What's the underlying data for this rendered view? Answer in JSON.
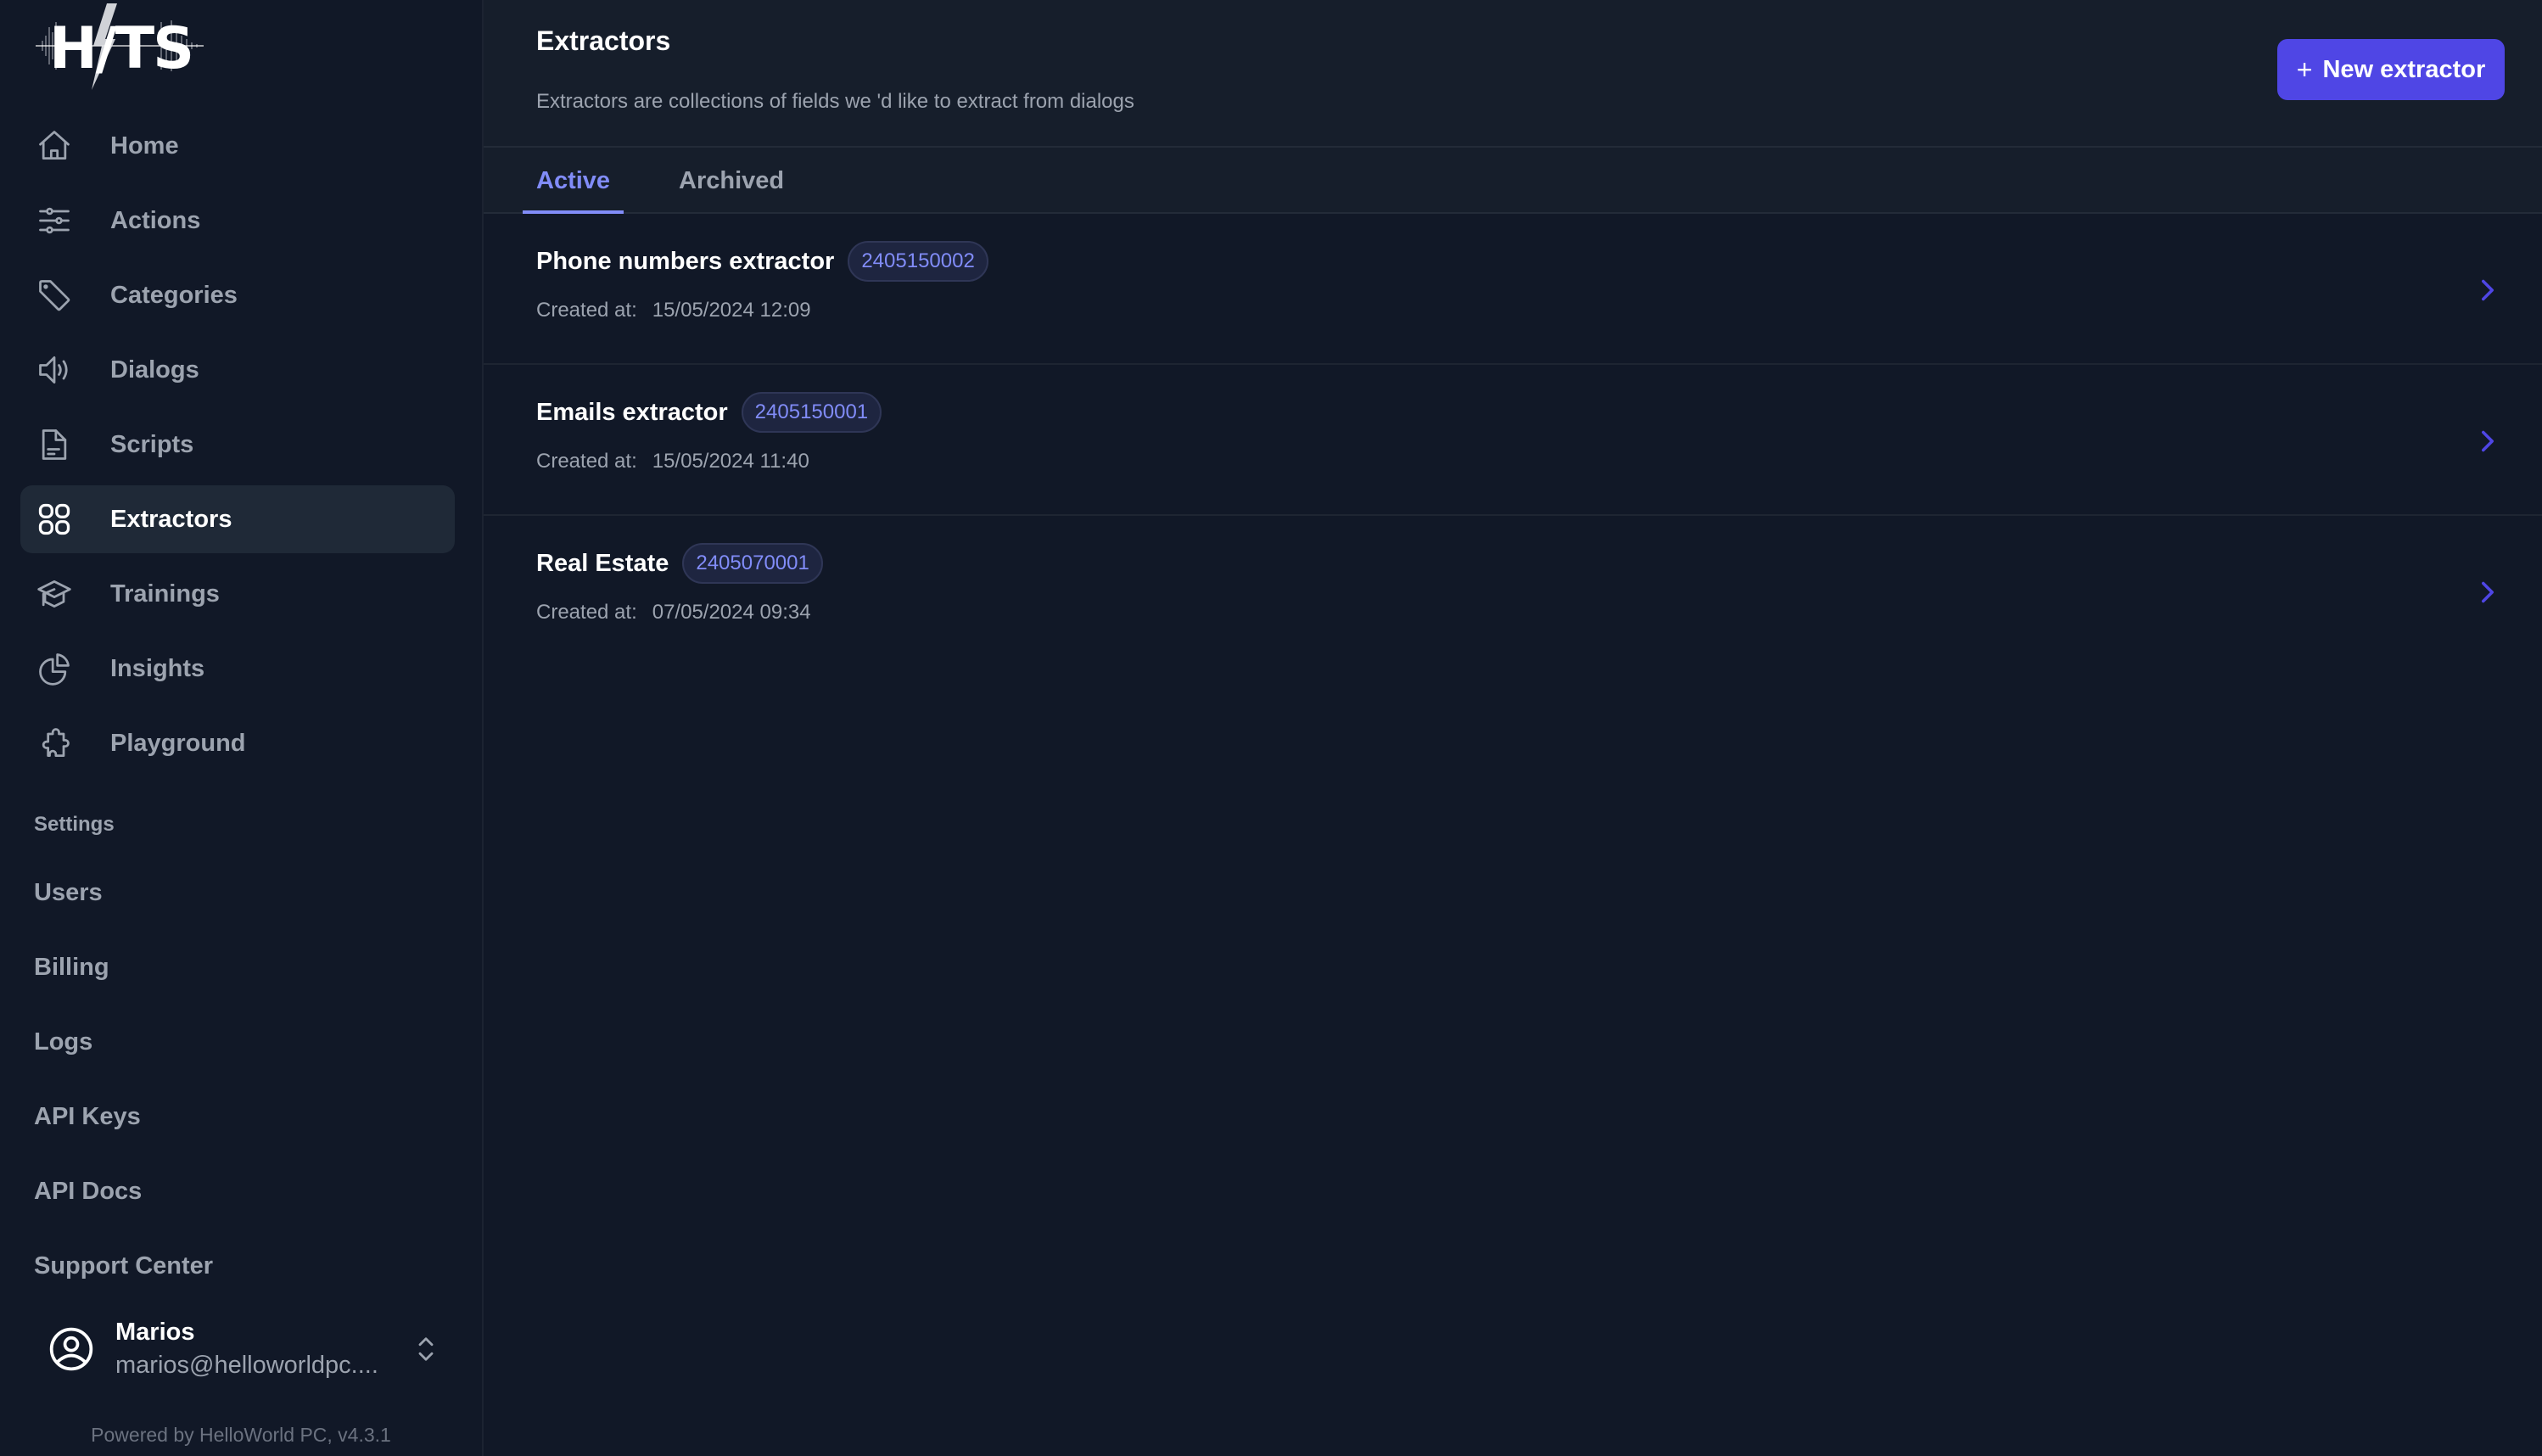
{
  "app": {
    "logo_text": "H/TS",
    "powered_by": "Powered by HelloWorld PC, v4.3.1"
  },
  "sidebar": {
    "items": [
      {
        "label": "Home",
        "icon": "home-icon",
        "active": false
      },
      {
        "label": "Actions",
        "icon": "sliders-icon",
        "active": false
      },
      {
        "label": "Categories",
        "icon": "tag-icon",
        "active": false
      },
      {
        "label": "Dialogs",
        "icon": "speaker-icon",
        "active": false
      },
      {
        "label": "Scripts",
        "icon": "document-icon",
        "active": false
      },
      {
        "label": "Extractors",
        "icon": "grid-icon",
        "active": true
      },
      {
        "label": "Trainings",
        "icon": "graduation-cap-icon",
        "active": false
      },
      {
        "label": "Insights",
        "icon": "pie-chart-icon",
        "active": false
      },
      {
        "label": "Playground",
        "icon": "puzzle-icon",
        "active": false
      }
    ],
    "settings_title": "Settings",
    "settings_items": [
      {
        "label": "Users"
      },
      {
        "label": "Billing"
      },
      {
        "label": "Logs"
      },
      {
        "label": "API Keys"
      },
      {
        "label": "API Docs"
      },
      {
        "label": "Support Center"
      }
    ],
    "user": {
      "name": "Marios",
      "email": "marios@helloworldpc...."
    }
  },
  "header": {
    "title": "Extractors",
    "subtitle": "Extractors are collections of fields we 'd like to extract from dialogs",
    "new_button_plus": "+",
    "new_button_label": "New extractor"
  },
  "tabs": [
    {
      "label": "Active",
      "active": true
    },
    {
      "label": "Archived",
      "active": false
    }
  ],
  "extractors": [
    {
      "name": "Phone numbers extractor",
      "id": "2405150002",
      "created_label": "Created at:",
      "created_at": "15/05/2024 12:09"
    },
    {
      "name": "Emails extractor",
      "id": "2405150001",
      "created_label": "Created at:",
      "created_at": "15/05/2024 11:40"
    },
    {
      "name": "Real Estate",
      "id": "2405070001",
      "created_label": "Created at:",
      "created_at": "07/05/2024 09:34"
    }
  ],
  "colors": {
    "accent": "#4f46e5",
    "accent_light": "#818cf8",
    "background": "#111827",
    "header_bg": "#161e2b",
    "active_nav_bg": "#1f2937"
  }
}
